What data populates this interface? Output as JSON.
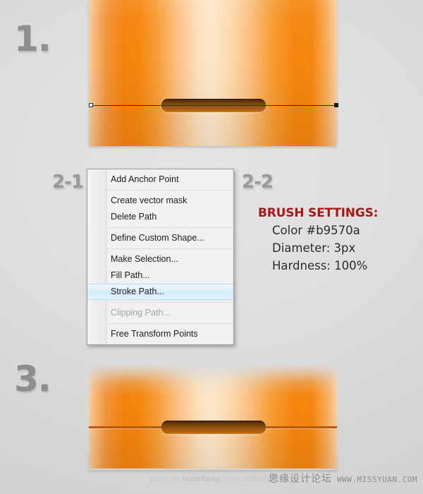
{
  "steps": {
    "step1_label": "1.",
    "step2a_label": "2-1",
    "step2b_label": "2-2",
    "step3_label": "3."
  },
  "context_menu": {
    "items": [
      {
        "label": "Add Anchor Point",
        "state": "normal",
        "separator_after": true
      },
      {
        "label": "Create vector mask",
        "state": "normal",
        "separator_after": false
      },
      {
        "label": "Delete Path",
        "state": "normal",
        "separator_after": true
      },
      {
        "label": "Define Custom Shape...",
        "state": "normal",
        "separator_after": true
      },
      {
        "label": "Make Selection...",
        "state": "normal",
        "separator_after": false
      },
      {
        "label": "Fill Path...",
        "state": "normal",
        "separator_after": false
      },
      {
        "label": "Stroke Path...",
        "state": "selected",
        "separator_after": true
      },
      {
        "label": "Clipping Path...",
        "state": "disabled",
        "separator_after": true
      },
      {
        "label": "Free Transform Points",
        "state": "normal",
        "separator_after": false
      }
    ]
  },
  "brush_settings": {
    "title": "BRUSH SETTINGS:",
    "color_line": "Color #b9570a",
    "diameter_line": "Diameter: 3px",
    "hardness_line": "Hardness: 100%",
    "title_color": "#a81616",
    "brush_color": "#b9570a"
  },
  "watermarks": {
    "left_prefix": "post at ",
    "left_brand": "iconfans",
    "left_suffix": ".com",
    "left_logo": "iconfans",
    "right_cn": "思缘设计论坛",
    "right_url": "WWW.MISSYUAN.COM"
  },
  "canvas": {
    "background_color": "#d9d9d9",
    "orange_light": "#fde7ca",
    "orange_deep": "#f5850f",
    "slot_dark": "#4c2608",
    "path_color": "#2a2f38"
  }
}
